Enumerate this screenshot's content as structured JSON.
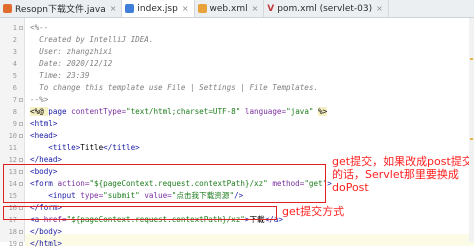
{
  "tabs": [
    {
      "label": "Resopn下载文件.java",
      "icon": "java-class-icon",
      "active": false
    },
    {
      "label": "index.jsp",
      "icon": "jsp-file-icon",
      "active": true
    },
    {
      "label": "web.xml",
      "icon": "xml-file-icon",
      "active": false
    },
    {
      "label": "pom.xml (servlet-03)",
      "icon": "maven-icon",
      "active": false
    }
  ],
  "tab_close_glyph": "×",
  "lines": [
    {
      "n": "1",
      "parts": [
        [
          "c-comment",
          "<%--"
        ]
      ]
    },
    {
      "n": "2",
      "parts": [
        [
          "c-comment",
          "  Created by IntelliJ IDEA."
        ]
      ]
    },
    {
      "n": "3",
      "parts": [
        [
          "c-comment",
          "  User: zhangzhixi"
        ]
      ]
    },
    {
      "n": "4",
      "parts": [
        [
          "c-comment",
          "  Date: 2020/12/12"
        ]
      ]
    },
    {
      "n": "5",
      "parts": [
        [
          "c-comment",
          "  Time: 23:39"
        ]
      ]
    },
    {
      "n": "6",
      "parts": [
        [
          "c-comment",
          "  To change this template use File | Settings | File Templates."
        ]
      ]
    },
    {
      "n": "7",
      "parts": [
        [
          "c-comment",
          "--%>"
        ]
      ]
    },
    {
      "n": "8",
      "parts": [
        [
          "c-dir",
          "<%@ "
        ],
        [
          "c-tag",
          "page "
        ],
        [
          "c-attr",
          "contentType="
        ],
        [
          "c-str",
          "\"text/html;charset=UTF-8\" "
        ],
        [
          "c-attr",
          "language="
        ],
        [
          "c-str",
          "\"java\" "
        ],
        [
          "c-dir",
          "%>"
        ]
      ]
    },
    {
      "n": "9",
      "parts": [
        [
          "c-tag",
          "<html>"
        ]
      ]
    },
    {
      "n": "10",
      "parts": [
        [
          "c-tag",
          "<head>"
        ]
      ]
    },
    {
      "n": "11",
      "parts": [
        [
          "c-tag",
          "    <title>"
        ],
        [
          "c-text",
          "Title"
        ],
        [
          "c-tag",
          "</title>"
        ]
      ]
    },
    {
      "n": "12",
      "parts": [
        [
          "c-tag",
          "</head>"
        ]
      ]
    },
    {
      "n": "13",
      "parts": [
        [
          "c-tag",
          "<body>"
        ]
      ]
    },
    {
      "n": "14",
      "parts": [
        [
          "c-tag",
          "<form "
        ],
        [
          "c-attr",
          "action="
        ],
        [
          "c-str",
          "\"${pageContext.request.contextPath}/xz\" "
        ],
        [
          "c-attr",
          "method="
        ],
        [
          "c-str",
          "\"get\""
        ],
        [
          "c-tag",
          ">"
        ]
      ]
    },
    {
      "n": "15",
      "parts": [
        [
          "c-tag",
          "    <input "
        ],
        [
          "c-attr",
          "type="
        ],
        [
          "c-str",
          "\"submit\" "
        ],
        [
          "c-attr",
          "value="
        ],
        [
          "c-str",
          "\"点击我下载资源\""
        ],
        [
          "c-tag",
          "/>"
        ]
      ]
    },
    {
      "n": "16",
      "parts": [
        [
          "c-tag",
          "</form>"
        ]
      ]
    },
    {
      "n": "17",
      "parts": [
        [
          "c-tag",
          "<a "
        ],
        [
          "c-attr",
          "href="
        ],
        [
          "c-str",
          "\"${pageContext.request.contextPath}/xz\""
        ],
        [
          "c-tag",
          ">"
        ],
        [
          "c-text",
          "下载"
        ],
        [
          "c-tag",
          "</a>"
        ]
      ]
    },
    {
      "n": "18",
      "parts": [
        [
          "c-tag",
          "</body>"
        ]
      ]
    },
    {
      "n": "19",
      "parts": [
        [
          "c-tag",
          "</html>"
        ]
      ]
    }
  ],
  "annotations": {
    "form_note": [
      "get提交，如果改成post提交",
      "的话，Servlet那里要换成",
      "doPost"
    ],
    "link_note": "get提交方式",
    "color": "#ff2020"
  }
}
